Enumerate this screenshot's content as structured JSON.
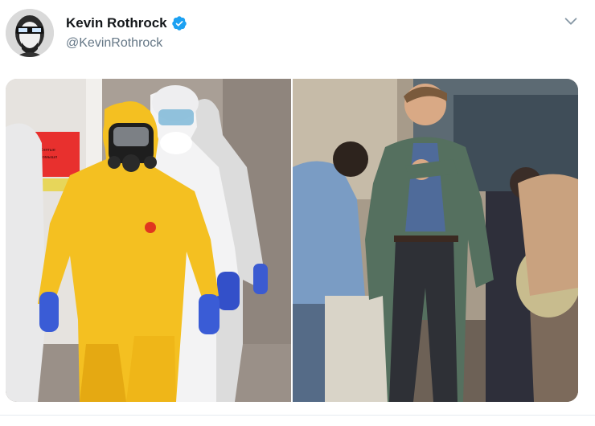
{
  "tweet": {
    "author": {
      "display_name": "Kevin Rothrock",
      "handle": "@KevinRothrock",
      "verified": true,
      "avatar_icon": "avatar-portrait",
      "verified_icon": "verified-badge-icon",
      "verified_color": "#1da1f2"
    },
    "menu_icon": "chevron-down-icon",
    "media": {
      "count": 2,
      "left_photo_sign": "Снятые\nпромышл"
    }
  },
  "colors": {
    "name": "#14171a",
    "handle": "#657786",
    "divider": "#e6ecf0"
  }
}
